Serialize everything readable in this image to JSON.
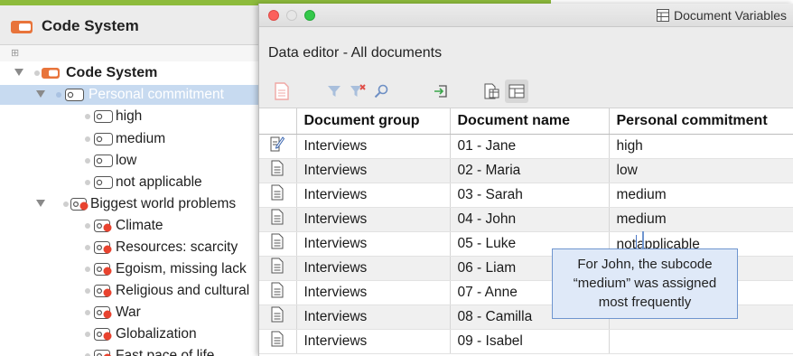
{
  "code_system_panel": {
    "header_title": "Code System",
    "tree": [
      {
        "label": "Code System",
        "level": 0,
        "kind": "root",
        "expanded": true
      },
      {
        "label": "Personal commitment",
        "level": 1,
        "kind": "code",
        "color": "#ffffff",
        "expanded": true,
        "selected": true
      },
      {
        "label": "high",
        "level": 2,
        "kind": "code",
        "color": "#ffffff"
      },
      {
        "label": "medium",
        "level": 2,
        "kind": "code",
        "color": "#ffffff"
      },
      {
        "label": "low",
        "level": 2,
        "kind": "code",
        "color": "#ffffff"
      },
      {
        "label": "not applicable",
        "level": 2,
        "kind": "code",
        "color": "#ffffff"
      },
      {
        "label": "Biggest world problems",
        "level": 1,
        "kind": "code",
        "color": "#e8432f",
        "expanded": true
      },
      {
        "label": "Climate",
        "level": 2,
        "kind": "code",
        "color": "#e8432f"
      },
      {
        "label": "Resources: scarcity",
        "level": 2,
        "kind": "code",
        "color": "#e8432f"
      },
      {
        "label": "Egoism, missing lack",
        "level": 2,
        "kind": "code",
        "color": "#e8432f"
      },
      {
        "label": "Religious and cultural",
        "level": 2,
        "kind": "code",
        "color": "#e8432f"
      },
      {
        "label": "War",
        "level": 2,
        "kind": "code",
        "color": "#e8432f"
      },
      {
        "label": "Globalization",
        "level": 2,
        "kind": "code",
        "color": "#e8432f"
      },
      {
        "label": "Fast pace of life",
        "level": 2,
        "kind": "code",
        "color": "#e8432f"
      }
    ]
  },
  "document_variables_window": {
    "window_title": "Document Variables",
    "subtitle": "Data editor - All documents",
    "toolbar_icons": [
      "new-document-icon",
      "filter-icon",
      "clear-filter-icon",
      "search-icon",
      "export-icon",
      "document-variables-view-icon",
      "data-view-icon"
    ],
    "columns": [
      "Document group",
      "Document name",
      "Personal commitment"
    ],
    "rows": [
      {
        "icon": "edit-document-icon",
        "group": "Interviews",
        "name": "01 - Jane",
        "commitment": "high"
      },
      {
        "icon": "document-icon",
        "group": "Interviews",
        "name": "02 - Maria",
        "commitment": "low"
      },
      {
        "icon": "document-icon",
        "group": "Interviews",
        "name": "03 - Sarah",
        "commitment": "medium"
      },
      {
        "icon": "document-icon",
        "group": "Interviews",
        "name": "04 - John",
        "commitment": "medium"
      },
      {
        "icon": "document-icon",
        "group": "Interviews",
        "name": "05 - Luke",
        "commitment_before_caret": "not",
        "commitment_after_caret": "applicable"
      },
      {
        "icon": "document-icon",
        "group": "Interviews",
        "name": "06 - Liam",
        "commitment": ""
      },
      {
        "icon": "document-icon",
        "group": "Interviews",
        "name": "07 - Anne",
        "commitment": ""
      },
      {
        "icon": "document-icon",
        "group": "Interviews",
        "name": "08 - Camilla",
        "commitment": ""
      },
      {
        "icon": "document-icon",
        "group": "Interviews",
        "name": "09 - Isabel",
        "commitment": ""
      }
    ]
  },
  "callout": {
    "line1": "For John, the subcode",
    "line2": "“medium” was assigned",
    "line3": "most frequently"
  },
  "colors": {
    "code_system_orange": "#e8743b",
    "code_red": "#e8432f",
    "selection_blue": "#c7daf0",
    "callout_fill": "#dfe9f8",
    "callout_border": "#6f95cf",
    "accent_green": "#8dbb3c"
  }
}
